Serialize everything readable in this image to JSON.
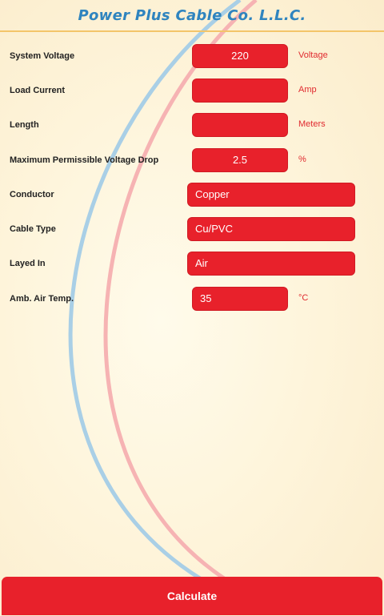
{
  "header": {
    "brand": "Power Plus Cable Co. L.L.C."
  },
  "form": {
    "system_voltage": {
      "label": "System Voltage",
      "value": "220",
      "unit": "Voltage"
    },
    "load_current": {
      "label": "Load Current",
      "value": "",
      "unit": "Amp"
    },
    "length": {
      "label": "Length",
      "value": "",
      "unit": "Meters"
    },
    "max_voltage_drop": {
      "label": "Maximum Permissible Voltage Drop",
      "value": "2.5",
      "unit": "%"
    },
    "conductor": {
      "label": "Conductor",
      "value": "Copper"
    },
    "cable_type": {
      "label": "Cable Type",
      "value": "Cu/PVC"
    },
    "layed_in": {
      "label": "Layed In",
      "value": "Air"
    },
    "amb_air_temp": {
      "label": "Amb. Air Temp.",
      "value": "35",
      "unit": "°C"
    }
  },
  "actions": {
    "calculate_label": "Calculate"
  },
  "colors": {
    "accent": "#e8212b",
    "brand_blue": "#2f84bf",
    "arc_blue": "#a9cfe6",
    "arc_pink": "#f6b3b3",
    "header_line": "#f3c56a"
  }
}
